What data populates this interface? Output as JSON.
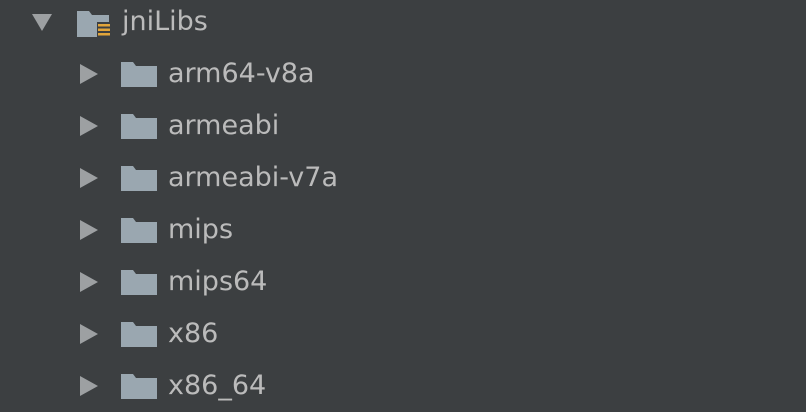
{
  "tree": {
    "root": {
      "label": "jniLibs",
      "icon": "resource-folder-icon",
      "expanded": true
    },
    "children": [
      {
        "label": "arm64-v8a",
        "icon": "folder-icon",
        "expanded": false
      },
      {
        "label": "armeabi",
        "icon": "folder-icon",
        "expanded": false
      },
      {
        "label": "armeabi-v7a",
        "icon": "folder-icon",
        "expanded": false
      },
      {
        "label": "mips",
        "icon": "folder-icon",
        "expanded": false
      },
      {
        "label": "mips64",
        "icon": "folder-icon",
        "expanded": false
      },
      {
        "label": "x86",
        "icon": "folder-icon",
        "expanded": false
      },
      {
        "label": "x86_64",
        "icon": "folder-icon",
        "expanded": false
      }
    ]
  },
  "colors": {
    "background": "#3c3f41",
    "text": "#bbbbbb",
    "arrow": "#9da0a2",
    "folder": "#9aa7b0",
    "resource_badge": "#e2a53a"
  }
}
